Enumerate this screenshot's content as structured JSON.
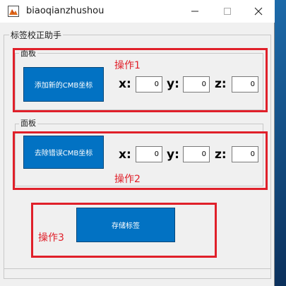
{
  "window": {
    "title": "biaoqianzhushou"
  },
  "panel_main": {
    "title": "标签校正助手"
  },
  "panel1": {
    "title": "面板",
    "op_label": "操作1",
    "button_label": "添加新的CMB坐标",
    "x_label": "x:",
    "y_label": "y:",
    "z_label": "z:",
    "x_value": "0",
    "y_value": "0",
    "z_value": "0"
  },
  "panel2": {
    "title": "面板",
    "op_label": "操作2",
    "button_label": "去除错误CMB坐标",
    "x_label": "x:",
    "y_label": "y:",
    "z_label": "z:",
    "x_value": "0",
    "y_value": "0",
    "z_value": "0"
  },
  "op3": {
    "op_label": "操作3",
    "button_label": "存储标签"
  },
  "colors": {
    "accent_red": "#e0202a",
    "button_blue": "#0272c3"
  },
  "icons": {
    "app": "matlab-figure-icon",
    "minimize": "minimize-icon",
    "maximize": "maximize-icon",
    "close": "close-icon"
  }
}
